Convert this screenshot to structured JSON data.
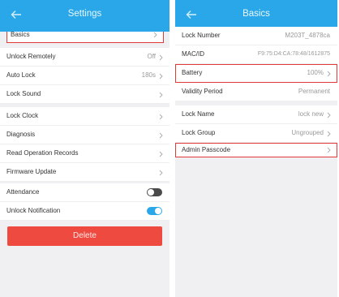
{
  "left": {
    "title": "Settings",
    "rows": [
      {
        "label": "Basics",
        "value": ""
      },
      {
        "label": "Unlock Remotely",
        "value": "Off"
      },
      {
        "label": "Auto Lock",
        "value": "180s"
      },
      {
        "label": "Lock Sound",
        "value": ""
      },
      {
        "label": "Lock Clock",
        "value": ""
      },
      {
        "label": "Diagnosis",
        "value": ""
      },
      {
        "label": "Read Operation Records",
        "value": ""
      },
      {
        "label": "Firmware Update",
        "value": ""
      },
      {
        "label": "Attendance",
        "toggle": false
      },
      {
        "label": "Unlock Notification",
        "toggle": true
      }
    ],
    "delete_label": "Delete"
  },
  "right": {
    "title": "Basics",
    "rows": [
      {
        "label": "Lock Number",
        "value": "M203T_4878ca"
      },
      {
        "label": "MAC/ID",
        "value": "F9:75:D4:CA:78:48/1612875"
      },
      {
        "label": "Battery",
        "value": "100%"
      },
      {
        "label": "Validity Period",
        "value": "Permanent"
      },
      {
        "label": "Lock Name",
        "value": "lock new"
      },
      {
        "label": "Lock Group",
        "value": "Ungrouped"
      },
      {
        "label": "Admin Passcode",
        "value": ""
      }
    ]
  },
  "colors": {
    "accent": "#2aa7e8",
    "danger": "#ef4a3f",
    "highlight": "#e03a3a"
  }
}
